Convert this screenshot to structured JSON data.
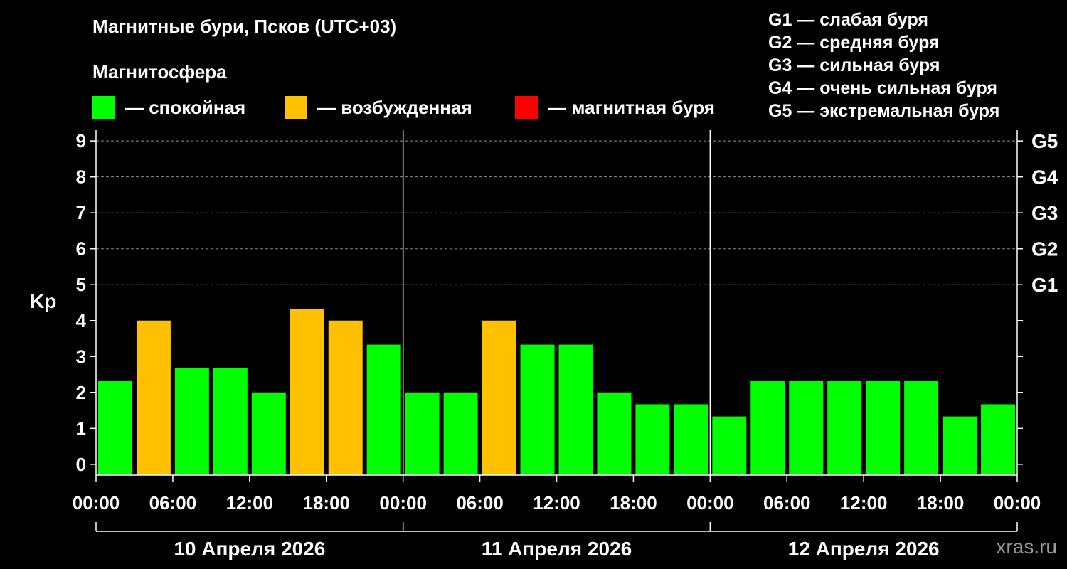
{
  "header": {
    "title": "Магнитные бури, Псков (UTC+03)",
    "subtitle": "Магнитосфера"
  },
  "legend": [
    {
      "label": "— спокойная",
      "color": "#00ff00"
    },
    {
      "label": "— возбужденная",
      "color": "#ffc000"
    },
    {
      "label": "— магнитная буря",
      "color": "#ff0000"
    }
  ],
  "storm_scale": [
    "G1 — слабая буря",
    "G2 — средняя буря",
    "G3 — сильная буря",
    "G4 — очень сильная буря",
    "G5 — экстремальная буря"
  ],
  "watermark": "xras.ru",
  "colors": {
    "quiet": "#00ff00",
    "active": "#ffc000",
    "storm": "#ff0000",
    "background": "#000000",
    "grid": "#888888"
  },
  "chart_data": {
    "type": "bar",
    "ylabel": "Kp",
    "ylim": [
      -0.3,
      9.3
    ],
    "y_ticks": [
      0,
      1,
      2,
      3,
      4,
      5,
      6,
      7,
      8,
      9
    ],
    "gridlines": [
      5,
      6,
      7,
      8,
      9
    ],
    "right_axis_labels": [
      {
        "value": 5,
        "label": "G1"
      },
      {
        "value": 6,
        "label": "G2"
      },
      {
        "value": 7,
        "label": "G3"
      },
      {
        "value": 8,
        "label": "G4"
      },
      {
        "value": 9,
        "label": "G5"
      }
    ],
    "x_tick_labels": [
      "00:00",
      "06:00",
      "12:00",
      "18:00",
      "00:00",
      "06:00",
      "12:00",
      "18:00",
      "00:00",
      "06:00",
      "12:00",
      "18:00",
      "00:00"
    ],
    "days": [
      "10 Апреля 2026",
      "11 Апреля 2026",
      "12 Апреля 2026"
    ],
    "interval_hours": 3,
    "values": [
      2.33,
      4.0,
      2.67,
      2.67,
      2.0,
      4.33,
      4.0,
      3.33,
      2.0,
      2.0,
      4.0,
      3.33,
      3.33,
      2.0,
      1.67,
      1.67,
      1.33,
      2.33,
      2.33,
      2.33,
      2.33,
      2.33,
      1.33,
      1.67
    ],
    "levels": [
      "quiet",
      "active",
      "quiet",
      "quiet",
      "quiet",
      "active",
      "active",
      "quiet",
      "quiet",
      "quiet",
      "active",
      "quiet",
      "quiet",
      "quiet",
      "quiet",
      "quiet",
      "quiet",
      "quiet",
      "quiet",
      "quiet",
      "quiet",
      "quiet",
      "quiet",
      "quiet"
    ]
  }
}
